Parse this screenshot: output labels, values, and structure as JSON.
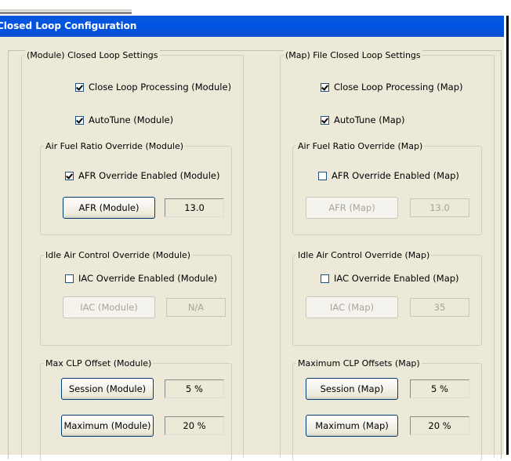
{
  "window": {
    "title": "Closed Loop Configuration"
  },
  "module": {
    "group_title": "(Module) Closed Loop Settings",
    "close_loop_processing": {
      "label": "Close Loop Processing (Module)",
      "checked": true
    },
    "autotune": {
      "label": "AutoTune (Module)",
      "checked": true
    },
    "afr_override": {
      "group_title": "Air Fuel Ratio Override (Module)",
      "enabled": {
        "label": "AFR Override Enabled (Module)",
        "checked": true
      },
      "button": "AFR (Module)",
      "value": "13.0"
    },
    "iac_override": {
      "group_title": "Idle Air Control Override (Module)",
      "enabled": {
        "label": "IAC Override Enabled (Module)",
        "checked": false
      },
      "button": "IAC (Module)",
      "value": "N/A"
    },
    "clp_offset": {
      "group_title": "Max CLP Offset (Module)",
      "session_button": "Session (Module)",
      "session_value": "5 %",
      "maximum_button": "Maximum (Module)",
      "maximum_value": "20 %"
    }
  },
  "map": {
    "group_title": "(Map) File Closed Loop Settings",
    "close_loop_processing": {
      "label": "Close Loop Processing (Map)",
      "checked": true
    },
    "autotune": {
      "label": "AutoTune (Map)",
      "checked": true
    },
    "afr_override": {
      "group_title": "Air Fuel Ratio Override (Map)",
      "enabled": {
        "label": "AFR Override Enabled (Map)",
        "checked": false
      },
      "button": "AFR (Map)",
      "value": "13.0"
    },
    "iac_override": {
      "group_title": "Idle Air Control Override (Map)",
      "enabled": {
        "label": "IAC Override Enabled (Map)",
        "checked": false
      },
      "button": "IAC (Map)",
      "value": "35"
    },
    "clp_offset": {
      "group_title": "Maximum CLP Offsets (Map)",
      "session_button": "Session (Map)",
      "session_value": "5 %",
      "maximum_button": "Maximum (Map)",
      "maximum_value": "20 %"
    }
  }
}
